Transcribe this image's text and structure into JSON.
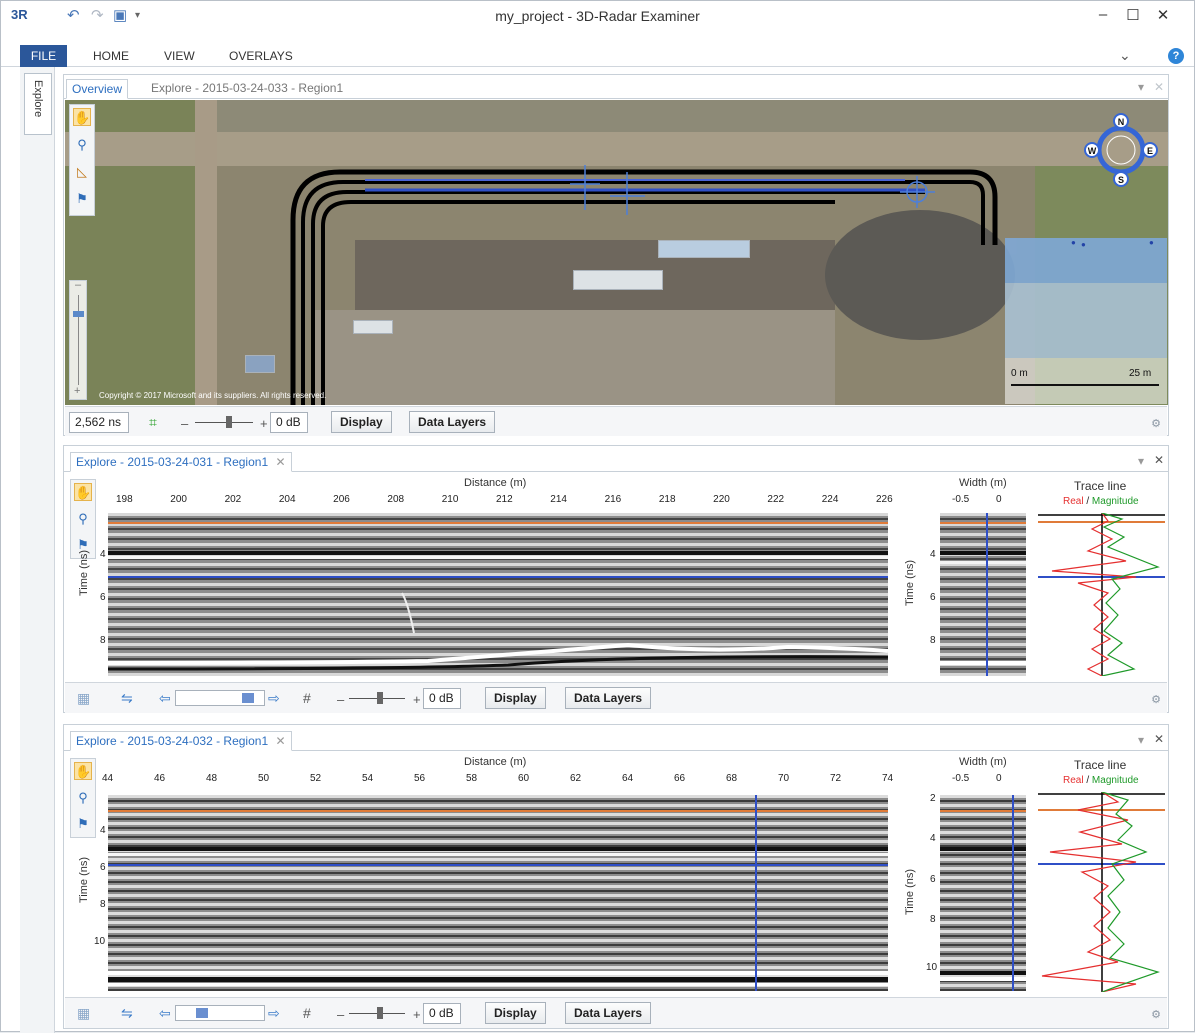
{
  "window": {
    "title": "my_project - 3D-Radar Examiner",
    "logo": "3R"
  },
  "quick_access": {
    "undo_icon": "undo-icon",
    "redo_icon": "redo-icon",
    "save_icon": "save-icon",
    "more_icon": "dropdown-icon"
  },
  "menu": {
    "file": "FILE",
    "home": "HOME",
    "view": "VIEW",
    "overlays": "OVERLAYS",
    "help": "?"
  },
  "rail": {
    "explore": "Explore"
  },
  "overview": {
    "tabs": [
      {
        "label": "Overview",
        "active": true
      },
      {
        "label": "Explore - 2015-03-24-033 - Region1",
        "active": false
      }
    ],
    "copyright": "Copyright © 2017 Microsoft and its suppliers. All rights reserved.",
    "compass": {
      "n": "N",
      "s": "S",
      "e": "E",
      "w": "W"
    },
    "scale": {
      "start": "0 m",
      "end": "25 m"
    },
    "status": {
      "time": "2,562 ns",
      "minus": "–",
      "plus": "+",
      "gain": "0 dB",
      "display": "Display",
      "data_layers": "Data Layers"
    }
  },
  "panel1": {
    "tab": "Explore - 2015-03-24-031 - Region1",
    "close": "✕",
    "distance_label": "Distance (m)",
    "distance_ticks": [
      "198",
      "200",
      "202",
      "204",
      "206",
      "208",
      "210",
      "212",
      "214",
      "216",
      "218",
      "220",
      "222",
      "224",
      "226"
    ],
    "time_label": "Time (ns)",
    "time_ticks": [
      "4",
      "6",
      "8"
    ],
    "width_label": "Width (m)",
    "width_ticks": [
      "-0.5",
      "0"
    ],
    "width_time_ticks": [
      "4",
      "6",
      "8"
    ],
    "trace_title": "Trace line",
    "trace_real": "Real",
    "trace_sep": " / ",
    "trace_mag": "Magnitude",
    "status": {
      "minus": "–",
      "plus": "+",
      "gain": "0 dB",
      "display": "Display",
      "data_layers": "Data Layers"
    }
  },
  "panel2": {
    "tab": "Explore - 2015-03-24-032 - Region1",
    "close": "✕",
    "distance_label": "Distance (m)",
    "distance_ticks": [
      "44",
      "46",
      "48",
      "50",
      "52",
      "54",
      "56",
      "58",
      "60",
      "62",
      "64",
      "66",
      "68",
      "70",
      "72",
      "74"
    ],
    "time_label": "Time (ns)",
    "time_ticks": [
      "4",
      "6",
      "8",
      "10"
    ],
    "width_label": "Width (m)",
    "width_ticks": [
      "-0.5",
      "0"
    ],
    "width_time_ticks": [
      "2",
      "4",
      "6",
      "8",
      "10"
    ],
    "trace_title": "Trace line",
    "trace_real": "Real",
    "trace_sep": " / ",
    "trace_mag": "Magnitude",
    "status": {
      "minus": "–",
      "plus": "+",
      "gain": "0 dB",
      "display": "Display",
      "data_layers": "Data Layers"
    }
  },
  "colors": {
    "accent": "#2b579a",
    "orange_line": "#e07b39",
    "blue_line": "#2f4fc7",
    "real_trace": "#e53030",
    "magnitude_trace": "#1f9a2a"
  }
}
